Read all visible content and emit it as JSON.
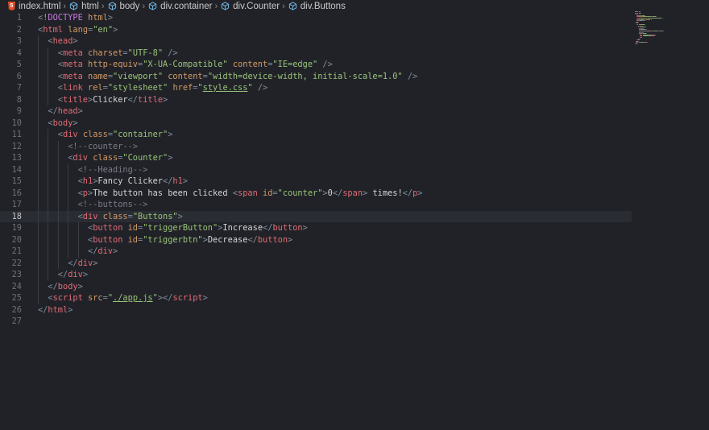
{
  "breadcrumb": [
    {
      "label": "index.html",
      "icon": "html5-icon"
    },
    {
      "label": "html",
      "icon": "cube-icon"
    },
    {
      "label": "body",
      "icon": "cube-icon"
    },
    {
      "label": "div.container",
      "icon": "cube-icon"
    },
    {
      "label": "div.Counter",
      "icon": "cube-icon"
    },
    {
      "label": "div.Buttons",
      "icon": "cube-icon"
    }
  ],
  "editor": {
    "current_line": 18,
    "lines": [
      {
        "n": "1",
        "indent": 0,
        "tokens": [
          [
            "t",
            "<"
          ],
          [
            "kw",
            "!DOCTYPE"
          ],
          [
            "txt",
            " "
          ],
          [
            "attr",
            "html"
          ],
          [
            "t",
            ">"
          ]
        ]
      },
      {
        "n": "2",
        "indent": 0,
        "tokens": [
          [
            "t",
            "<"
          ],
          [
            "tag",
            "html"
          ],
          [
            "txt",
            " "
          ],
          [
            "attr",
            "lang"
          ],
          [
            "t",
            "="
          ],
          [
            "str",
            "\"en\""
          ],
          [
            "t",
            ">"
          ]
        ]
      },
      {
        "n": "3",
        "indent": 1,
        "tokens": [
          [
            "t",
            "<"
          ],
          [
            "tag",
            "head"
          ],
          [
            "t",
            ">"
          ]
        ]
      },
      {
        "n": "4",
        "indent": 2,
        "tokens": [
          [
            "t",
            "<"
          ],
          [
            "tag",
            "meta"
          ],
          [
            "txt",
            " "
          ],
          [
            "attr",
            "charset"
          ],
          [
            "t",
            "="
          ],
          [
            "str",
            "\"UTF-8\""
          ],
          [
            "txt",
            " "
          ],
          [
            "t",
            "/>"
          ]
        ]
      },
      {
        "n": "5",
        "indent": 2,
        "tokens": [
          [
            "t",
            "<"
          ],
          [
            "tag",
            "meta"
          ],
          [
            "txt",
            " "
          ],
          [
            "attr",
            "http-equiv"
          ],
          [
            "t",
            "="
          ],
          [
            "str",
            "\"X-UA-Compatible\""
          ],
          [
            "txt",
            " "
          ],
          [
            "attr",
            "content"
          ],
          [
            "t",
            "="
          ],
          [
            "str",
            "\"IE=edge\""
          ],
          [
            "txt",
            " "
          ],
          [
            "t",
            "/>"
          ]
        ]
      },
      {
        "n": "6",
        "indent": 2,
        "tokens": [
          [
            "t",
            "<"
          ],
          [
            "tag",
            "meta"
          ],
          [
            "txt",
            " "
          ],
          [
            "attr",
            "name"
          ],
          [
            "t",
            "="
          ],
          [
            "str",
            "\"viewport\""
          ],
          [
            "txt",
            " "
          ],
          [
            "attr",
            "content"
          ],
          [
            "t",
            "="
          ],
          [
            "str",
            "\"width=device-width, initial-scale=1.0\""
          ],
          [
            "txt",
            " "
          ],
          [
            "t",
            "/>"
          ]
        ]
      },
      {
        "n": "7",
        "indent": 2,
        "tokens": [
          [
            "t",
            "<"
          ],
          [
            "tag",
            "link"
          ],
          [
            "txt",
            " "
          ],
          [
            "attr",
            "rel"
          ],
          [
            "t",
            "="
          ],
          [
            "str",
            "\"stylesheet\""
          ],
          [
            "txt",
            " "
          ],
          [
            "attr",
            "href"
          ],
          [
            "t",
            "="
          ],
          [
            "str",
            "\""
          ],
          [
            "str u",
            "style.css"
          ],
          [
            "str",
            "\""
          ],
          [
            "txt",
            " "
          ],
          [
            "t",
            "/>"
          ]
        ]
      },
      {
        "n": "8",
        "indent": 2,
        "tokens": [
          [
            "t",
            "<"
          ],
          [
            "tag",
            "title"
          ],
          [
            "t",
            ">"
          ],
          [
            "txt",
            "Clicker"
          ],
          [
            "t",
            "</"
          ],
          [
            "tag",
            "title"
          ],
          [
            "t",
            ">"
          ]
        ]
      },
      {
        "n": "9",
        "indent": 1,
        "tokens": [
          [
            "t",
            "</"
          ],
          [
            "tag",
            "head"
          ],
          [
            "t",
            ">"
          ]
        ]
      },
      {
        "n": "10",
        "indent": 1,
        "tokens": [
          [
            "t",
            "<"
          ],
          [
            "tag",
            "body"
          ],
          [
            "t",
            ">"
          ]
        ]
      },
      {
        "n": "11",
        "indent": 2,
        "tokens": [
          [
            "t",
            "<"
          ],
          [
            "tag",
            "div"
          ],
          [
            "txt",
            " "
          ],
          [
            "attr",
            "class"
          ],
          [
            "t",
            "="
          ],
          [
            "str",
            "\"container\""
          ],
          [
            "t",
            ">"
          ]
        ]
      },
      {
        "n": "12",
        "indent": 3,
        "tokens": [
          [
            "cmt",
            "<!--counter-->"
          ]
        ]
      },
      {
        "n": "13",
        "indent": 3,
        "tokens": [
          [
            "t",
            "<"
          ],
          [
            "tag",
            "div"
          ],
          [
            "txt",
            " "
          ],
          [
            "attr",
            "class"
          ],
          [
            "t",
            "="
          ],
          [
            "str",
            "\"Counter\""
          ],
          [
            "t",
            ">"
          ]
        ]
      },
      {
        "n": "14",
        "indent": 4,
        "tokens": [
          [
            "cmt",
            "<!--Heading-->"
          ]
        ]
      },
      {
        "n": "15",
        "indent": 4,
        "tokens": [
          [
            "t",
            "<"
          ],
          [
            "tag",
            "h1"
          ],
          [
            "t",
            ">"
          ],
          [
            "txt",
            "Fancy Clicker"
          ],
          [
            "t",
            "</"
          ],
          [
            "tag",
            "h1"
          ],
          [
            "t",
            ">"
          ]
        ]
      },
      {
        "n": "16",
        "indent": 4,
        "tokens": [
          [
            "t",
            "<"
          ],
          [
            "tag",
            "p"
          ],
          [
            "t",
            ">"
          ],
          [
            "txt",
            "The button has been clicked "
          ],
          [
            "t",
            "<"
          ],
          [
            "tag",
            "span"
          ],
          [
            "txt",
            " "
          ],
          [
            "attr",
            "id"
          ],
          [
            "t",
            "="
          ],
          [
            "str",
            "\"counter\""
          ],
          [
            "t",
            ">"
          ],
          [
            "txt",
            "0"
          ],
          [
            "t",
            "</"
          ],
          [
            "tag",
            "span"
          ],
          [
            "t",
            ">"
          ],
          [
            "txt",
            " times!"
          ],
          [
            "t",
            "</"
          ],
          [
            "tag",
            "p"
          ],
          [
            "t",
            ">"
          ]
        ]
      },
      {
        "n": "17",
        "indent": 4,
        "tokens": [
          [
            "cmt",
            "<!--buttons-->"
          ]
        ]
      },
      {
        "n": "18",
        "indent": 4,
        "tokens": [
          [
            "t",
            "<"
          ],
          [
            "tag",
            "div"
          ],
          [
            "txt",
            " "
          ],
          [
            "attr",
            "class"
          ],
          [
            "t",
            "="
          ],
          [
            "str",
            "\"Buttons\""
          ],
          [
            "t",
            ">"
          ]
        ]
      },
      {
        "n": "19",
        "indent": 5,
        "tokens": [
          [
            "t",
            "<"
          ],
          [
            "tag",
            "button"
          ],
          [
            "txt",
            " "
          ],
          [
            "attr",
            "id"
          ],
          [
            "t",
            "="
          ],
          [
            "str",
            "\"triggerButton\""
          ],
          [
            "t",
            ">"
          ],
          [
            "txt",
            "Increase"
          ],
          [
            "t",
            "</"
          ],
          [
            "tag",
            "button"
          ],
          [
            "t",
            ">"
          ]
        ]
      },
      {
        "n": "20",
        "indent": 5,
        "tokens": [
          [
            "t",
            "<"
          ],
          [
            "tag",
            "button"
          ],
          [
            "txt",
            " "
          ],
          [
            "attr",
            "id"
          ],
          [
            "t",
            "="
          ],
          [
            "str",
            "\"triggerbtn\""
          ],
          [
            "t",
            ">"
          ],
          [
            "txt",
            "Decrease"
          ],
          [
            "t",
            "</"
          ],
          [
            "tag",
            "button"
          ],
          [
            "t",
            ">"
          ]
        ]
      },
      {
        "n": "21",
        "indent": 5,
        "tokens": [
          [
            "t",
            "</"
          ],
          [
            "tag",
            "div"
          ],
          [
            "t",
            ">"
          ]
        ]
      },
      {
        "n": "22",
        "indent": 3,
        "tokens": [
          [
            "t",
            "</"
          ],
          [
            "tag",
            "div"
          ],
          [
            "t",
            ">"
          ]
        ]
      },
      {
        "n": "23",
        "indent": 2,
        "tokens": [
          [
            "t",
            "</"
          ],
          [
            "tag",
            "div"
          ],
          [
            "t",
            ">"
          ]
        ]
      },
      {
        "n": "24",
        "indent": 1,
        "tokens": [
          [
            "t",
            "</"
          ],
          [
            "tag",
            "body"
          ],
          [
            "t",
            ">"
          ]
        ]
      },
      {
        "n": "25",
        "indent": 1,
        "tokens": [
          [
            "t",
            "<"
          ],
          [
            "tag",
            "script"
          ],
          [
            "txt",
            " "
          ],
          [
            "attr",
            "src"
          ],
          [
            "t",
            "="
          ],
          [
            "str",
            "\""
          ],
          [
            "str u",
            "./app.js"
          ],
          [
            "str",
            "\""
          ],
          [
            "t",
            "></"
          ],
          [
            "tag",
            "script"
          ],
          [
            "t",
            ">"
          ]
        ]
      },
      {
        "n": "26",
        "indent": 0,
        "tokens": [
          [
            "t",
            "</"
          ],
          [
            "tag",
            "html"
          ],
          [
            "t",
            ">"
          ]
        ]
      },
      {
        "n": "27",
        "indent": 0,
        "tokens": []
      }
    ]
  },
  "colors": {
    "background": "#212228",
    "tag": "#e06c75",
    "attribute": "#d19a66",
    "string": "#98c379",
    "comment": "#7a7d86"
  }
}
